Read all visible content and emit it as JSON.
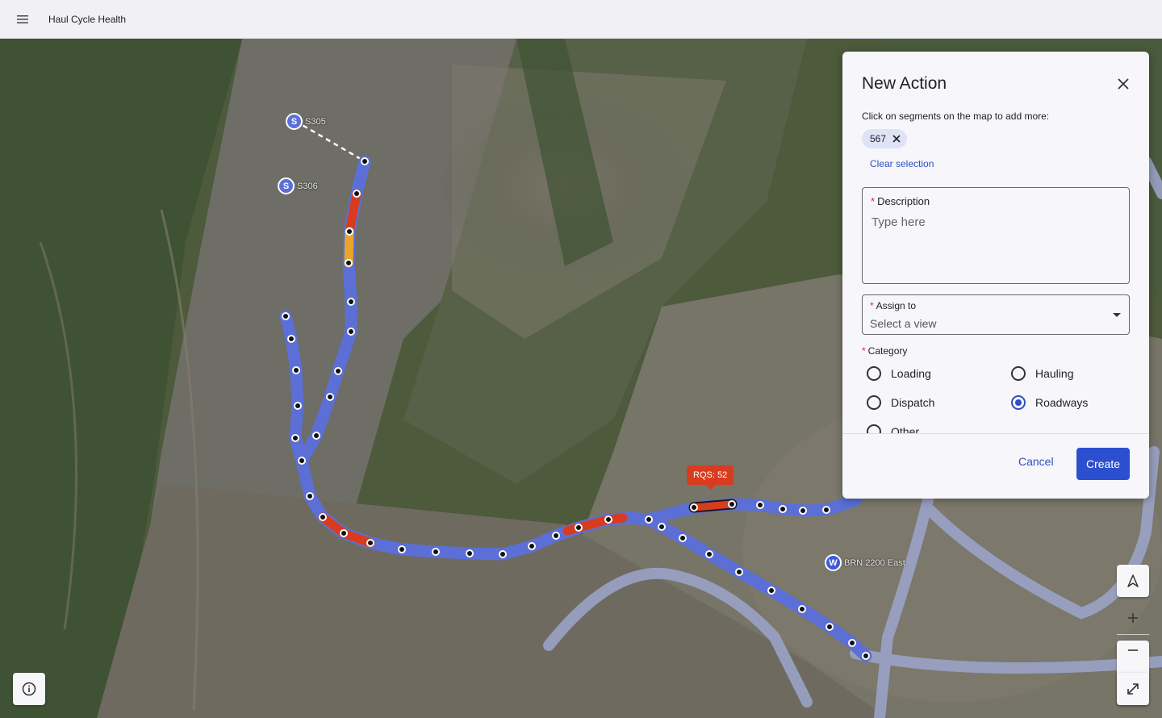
{
  "app": {
    "title": "Haul Cycle Health"
  },
  "map": {
    "markers": [
      {
        "letter": "S",
        "label": "S305",
        "color": "#5b6fd6"
      },
      {
        "letter": "S",
        "label": "S306",
        "color": "#5b6fd6"
      },
      {
        "letter": "W",
        "label": "BRN 2200 East",
        "color": "#3d5bd9"
      }
    ],
    "rqs_tag": "RQS: 52",
    "colors": {
      "road_ok": "#5b6fd6",
      "road_bad": "#d93b1f",
      "road_warn": "#e8a628",
      "road_inactive": "#9aa3c7"
    },
    "controls": {
      "compass_icon": "navigation-arrow-icon",
      "zoom_in_icon": "plus-icon",
      "zoom_out_icon": "minus-icon",
      "fullscreen_icon": "expand-icon",
      "info_icon": "info-icon"
    }
  },
  "panel": {
    "title": "New Action",
    "instructions": "Click on segments on the map to add more:",
    "chips": [
      "567"
    ],
    "clear_label": "Clear selection",
    "description": {
      "label": "Description",
      "placeholder": "Type here",
      "value": ""
    },
    "assign": {
      "label": "Assign to",
      "placeholder": "Select a view"
    },
    "category": {
      "label": "Category",
      "options": [
        "Loading",
        "Hauling",
        "Dispatch",
        "Roadways",
        "Other"
      ],
      "selected": "Roadways"
    },
    "cancel_label": "Cancel",
    "create_label": "Create",
    "accent": "#2c4fcf"
  }
}
